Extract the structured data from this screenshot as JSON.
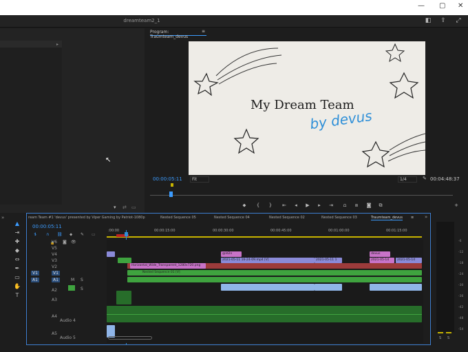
{
  "window": {
    "title": "dreamteam2_1",
    "controls": [
      "—",
      "▢",
      "✕"
    ]
  },
  "program_monitor": {
    "tab_label": "Program: Traumteam_devus",
    "menu_glyph": "≡",
    "timecode": "00:00:05:11",
    "fit": "Fit",
    "ratio": "1/4",
    "duration": "00:04:48:37",
    "video_text_line1": "My Dream Team",
    "video_text_line2": "by devus"
  },
  "timeline": {
    "tabs": [
      "ream Team  #1 'devus' presented by Viper Gaming by Patriot-1080p",
      "Nested Sequence 05",
      "Nested Sequence 04",
      "Nested Sequence 02",
      "Nested Sequence 03",
      "Traumteam_devus"
    ],
    "active_tab_menu": "≡",
    "timecode": "00:00:05:11",
    "ruler": [
      ":00:00",
      "00:00:15:00",
      "00:00:30:00",
      "00:00:45:00",
      "00:01:00:00",
      "00:01:15:00"
    ],
    "video_tracks": [
      "V6",
      "V5",
      "V4",
      "V3",
      "V2",
      "V1"
    ],
    "audio_tracks": [
      "A1",
      "A2",
      "A3",
      "A4",
      "A5"
    ],
    "source_patch_v": "V1",
    "source_patch_a": "A1",
    "audio_names": {
      "a4": "Audio 4",
      "a5": "Audio 5"
    },
    "clip_labels": {
      "horizontal": "Horizontal_Wide_Transparent_1280x720.png",
      "nested": "Nested Sequence 01 [V]",
      "clip_a": "2021-05-11 16-24-09.mp4 [V]",
      "clip_b": "2021-05-11 1",
      "clip_c": "2021-05-14",
      "clip_d": "2021-05-14",
      "label_a": "@ld2n",
      "label_b": "devus"
    },
    "track_buttons": {
      "m": "M",
      "s": "S"
    }
  },
  "meter_labels": [
    "-6",
    "-12",
    "-18",
    "-24",
    "-30",
    "-36",
    "-42",
    "-48",
    "-54"
  ],
  "meter_bottom": [
    "S",
    "S"
  ],
  "colors": {
    "accent": "#3c9cff",
    "playhead": "#2e8fd8",
    "clip_green": "#3fa33f",
    "clip_pink": "#c873c8",
    "clip_purple": "#8a8ad8",
    "clip_red": "#9c3b3b",
    "audio_green": "#276d2a",
    "light_blue": "#8fb5e8",
    "panel": "#232323",
    "title_bar": "#ffffff"
  }
}
